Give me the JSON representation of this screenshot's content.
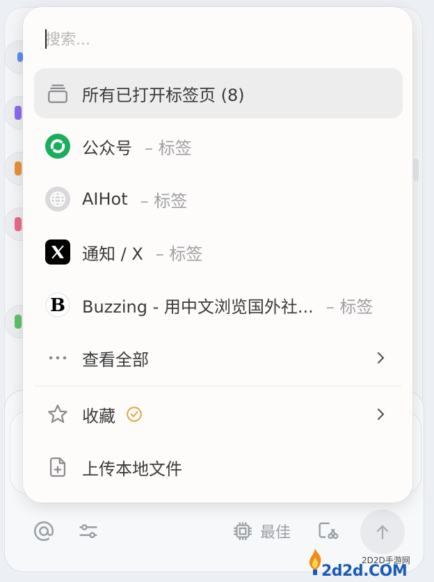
{
  "search": {
    "placeholder": "搜索..."
  },
  "tabs_group": {
    "label": "所有已打开标签页 (8)"
  },
  "tabs": [
    {
      "label": "公众号",
      "suffix": "– 标签",
      "icon": "wechat-icon"
    },
    {
      "label": "AIHot",
      "suffix": "– 标签",
      "icon": "globe-icon"
    },
    {
      "label": "通知 / X",
      "suffix": "– 标签",
      "icon": "x-logo-icon"
    },
    {
      "label": "Buzzing - 用中文浏览国外社...",
      "suffix": "– 标签",
      "icon": "buzzing-logo-icon"
    }
  ],
  "view_all": {
    "label": "查看全部"
  },
  "favorites": {
    "label": "收藏"
  },
  "upload": {
    "label": "上传本地文件"
  },
  "toolbar": {
    "model_label": "最佳"
  },
  "watermark": {
    "top": "2D2D手游网",
    "bottom": "2d2d.COM"
  },
  "colors": {
    "accent_badge": "#e0a23c",
    "wechat_green": "#1aad5c"
  }
}
